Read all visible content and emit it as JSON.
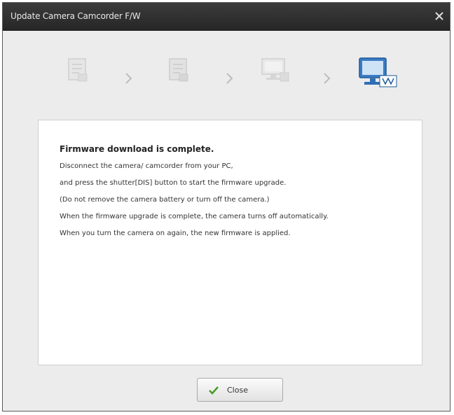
{
  "window": {
    "title": "Update Camera Camcorder F/W"
  },
  "steps": {
    "icons": [
      "document-icon",
      "document-icon",
      "computer-icon",
      "computer-download-icon"
    ],
    "active_step": 4,
    "chevron": "›"
  },
  "message": {
    "title": "Firmware download is complete.",
    "lines": [
      "Disconnect the camera/ camcorder from your PC,",
      "and press the shutter[DIS] button to start the firmware upgrade.",
      "(Do not remove the camera battery or turn off the camera.)",
      "When the firmware upgrade is complete, the camera turns off automatically.",
      "When you turn the camera on again, the new firmware is applied."
    ]
  },
  "buttons": {
    "close_label": "Close"
  },
  "colors": {
    "titlebar": "#2e2e2e",
    "active_icon": "#2f6fb5",
    "check": "#4a9a2a"
  }
}
